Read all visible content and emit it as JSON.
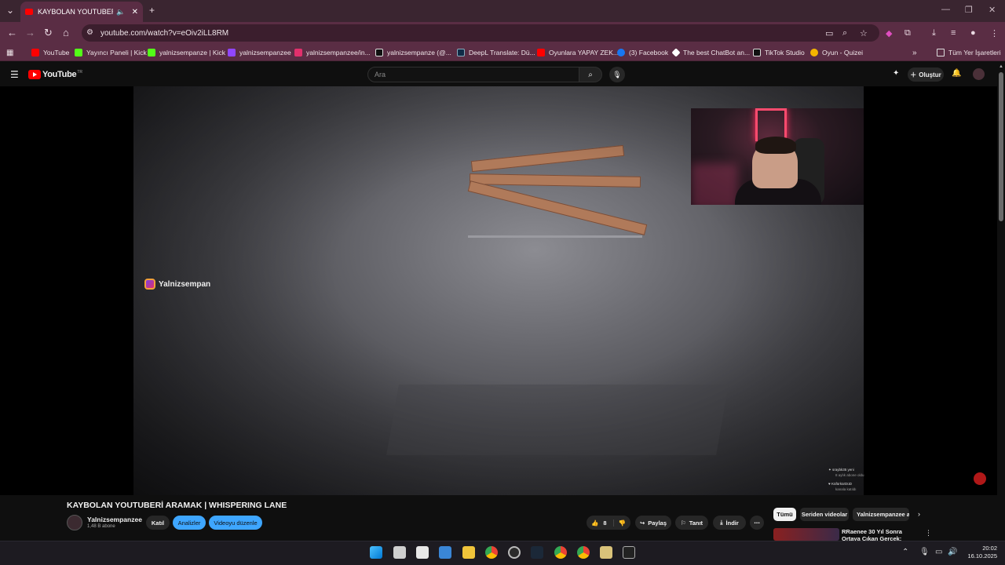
{
  "browser": {
    "tab_title": "KAYBOLAN YOUTUBERİ AR",
    "url": "youtube.com/watch?v=eOiv2iLL8RM",
    "bookmarks": [
      {
        "label": "YouTube",
        "color": "#ff0000"
      },
      {
        "label": "Yayıncı Paneli | Kick",
        "color": "#53fc18"
      },
      {
        "label": "yalnizsempanze | Kick",
        "color": "#53fc18"
      },
      {
        "label": "yalnizsempanzee",
        "color": "#9146ff"
      },
      {
        "label": "yalnizsempanzee/in...",
        "color": "#e1306c"
      },
      {
        "label": "yalnizsempanze (@...",
        "color": "#111111"
      },
      {
        "label": "DeepL Translate: Dü...",
        "color": "#0f2b46"
      },
      {
        "label": "Oyunlara YAPAY ZEK...",
        "color": "#ff0000"
      },
      {
        "label": "(3) Facebook",
        "color": "#1877f2"
      },
      {
        "label": "The best ChatBot an...",
        "color": "#ffffff"
      },
      {
        "label": "TikTok Studio",
        "color": "#111111"
      },
      {
        "label": "Oyun - Quizei",
        "color": "#f4b400"
      }
    ],
    "all_bookmarks": "Tüm Yer İşaretleri"
  },
  "youtube": {
    "logo_text": "YouTube",
    "logo_region": "TR",
    "search_placeholder": "Ara",
    "create_label": "Oluştur"
  },
  "video": {
    "instagram_handle": "Yalnizsempan",
    "notif_1a": "sraybk35 yeni",
    "notif_1b": "8 aylık abone oldu",
    "notif_2a": "KüfürkürDüD",
    "notif_2b": "kanala katıldı"
  },
  "meta": {
    "title": "KAYBOLAN YOUTUBERİ ARAMAK | WHISPERING LANE",
    "channel": "Yalnizsempanzee",
    "subscribers": "1,48 B abone",
    "join": "Katıl",
    "analytics": "Analizler",
    "edit": "Videoyu düzenle",
    "likes": "8",
    "share": "Paylaş",
    "promote": "Tanıt",
    "download": "İndir"
  },
  "sidebar": {
    "chips": [
      "Tümü",
      "Seriden videolar",
      "Yalnizsempanzee adlı"
    ],
    "rec_title": "RRaenee 30 Yıl Sonra Ortaya Çıkan Gerçek: Rewae Marmaris"
  },
  "taskbar": {
    "time": "20:02",
    "date": "16.10.2025"
  }
}
